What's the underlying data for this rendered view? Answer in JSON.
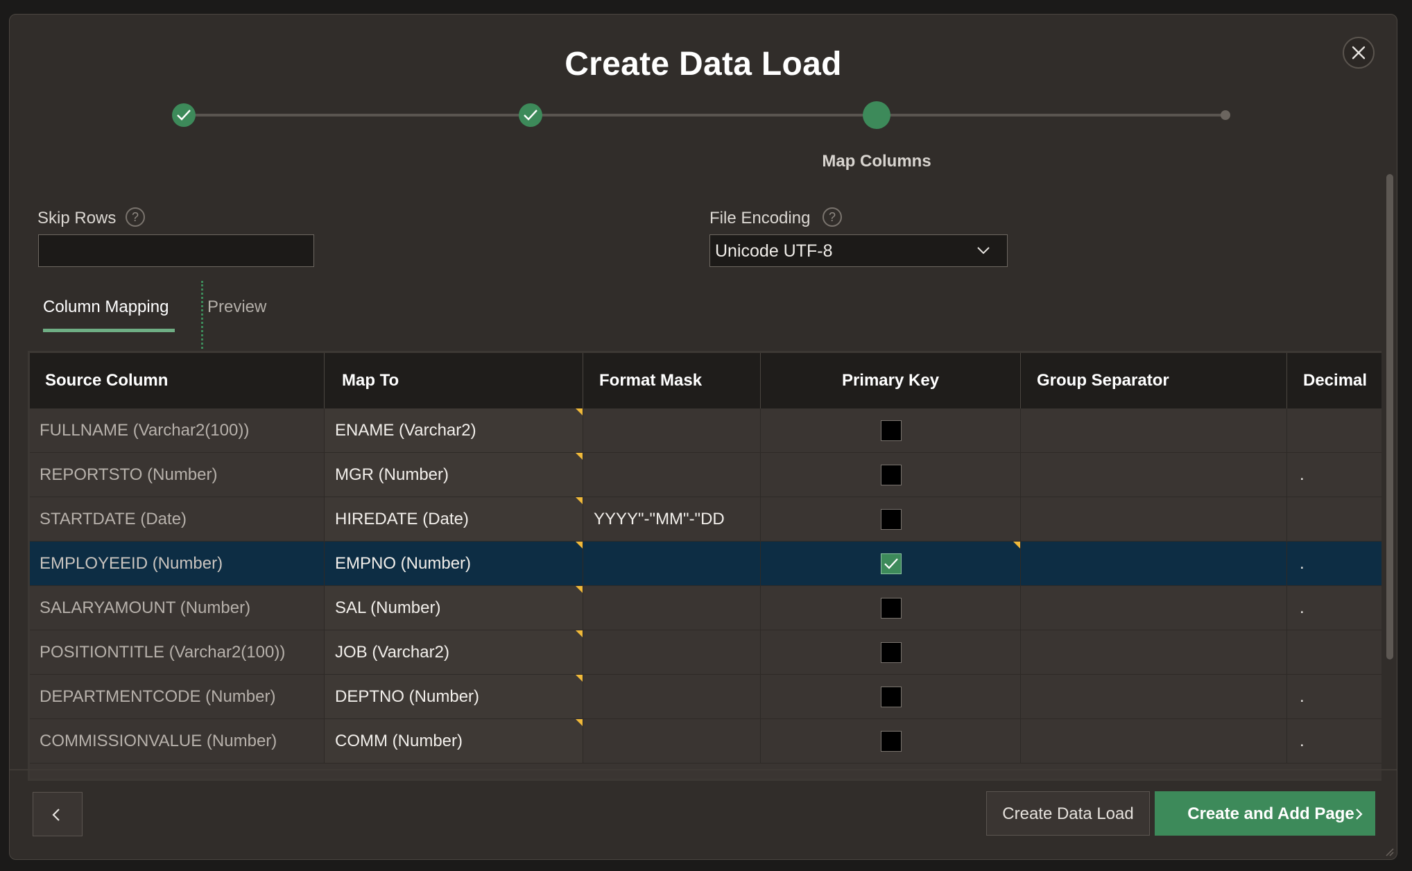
{
  "dialog": {
    "title": "Create Data Load",
    "close_icon": "close-icon"
  },
  "wizard": {
    "steps": [
      {
        "state": "complete",
        "icon": "check-icon"
      },
      {
        "state": "complete",
        "icon": "check-icon"
      },
      {
        "state": "current",
        "label": "Map Columns"
      },
      {
        "state": "pending"
      }
    ]
  },
  "form": {
    "skip_rows": {
      "label": "Skip Rows",
      "value": "",
      "help_icon": "help-icon"
    },
    "file_encoding": {
      "label": "File Encoding",
      "value": "Unicode UTF-8",
      "help_icon": "help-icon"
    }
  },
  "tabs": [
    {
      "label": "Column Mapping",
      "active": true
    },
    {
      "label": "Preview",
      "active": false
    }
  ],
  "grid": {
    "columns": [
      "Source Column",
      "Map To",
      "Format Mask",
      "Primary Key",
      "Group Separator",
      "Decimal"
    ],
    "rows": [
      {
        "source": "FULLNAME (Varchar2(100))",
        "map_to": "ENAME (Varchar2)",
        "format_mask": "",
        "primary_key": false,
        "group_separator": "",
        "decimal": ""
      },
      {
        "source": "REPORTSTO (Number)",
        "map_to": "MGR (Number)",
        "format_mask": "",
        "primary_key": false,
        "group_separator": "",
        "decimal": "."
      },
      {
        "source": "STARTDATE (Date)",
        "map_to": "HIREDATE (Date)",
        "format_mask": "YYYY\"-\"MM\"-\"DD",
        "primary_key": false,
        "group_separator": "",
        "decimal": ""
      },
      {
        "source": "EMPLOYEEID (Number)",
        "map_to": "EMPNO (Number)",
        "format_mask": "",
        "primary_key": true,
        "group_separator": "",
        "decimal": ".",
        "selected": true
      },
      {
        "source": "SALARYAMOUNT (Number)",
        "map_to": "SAL (Number)",
        "format_mask": "",
        "primary_key": false,
        "group_separator": "",
        "decimal": "."
      },
      {
        "source": "POSITIONTITLE (Varchar2(100))",
        "map_to": "JOB (Varchar2)",
        "format_mask": "",
        "primary_key": false,
        "group_separator": "",
        "decimal": ""
      },
      {
        "source": "DEPARTMENTCODE (Number)",
        "map_to": "DEPTNO (Number)",
        "format_mask": "",
        "primary_key": false,
        "group_separator": "",
        "decimal": "."
      },
      {
        "source": "COMMISSIONVALUE (Number)",
        "map_to": "COMM (Number)",
        "format_mask": "",
        "primary_key": false,
        "group_separator": "",
        "decimal": "."
      }
    ]
  },
  "footer": {
    "back_icon": "chevron-left-icon",
    "secondary_label": "Create Data Load",
    "primary_label": "Create and Add Page",
    "primary_icon": "chevron-right-icon"
  },
  "colors": {
    "accent": "#3d8a5a",
    "selected_row": "#0d2d44",
    "dialog_bg": "#312d2a",
    "modified_marker": "#f0b93a"
  }
}
